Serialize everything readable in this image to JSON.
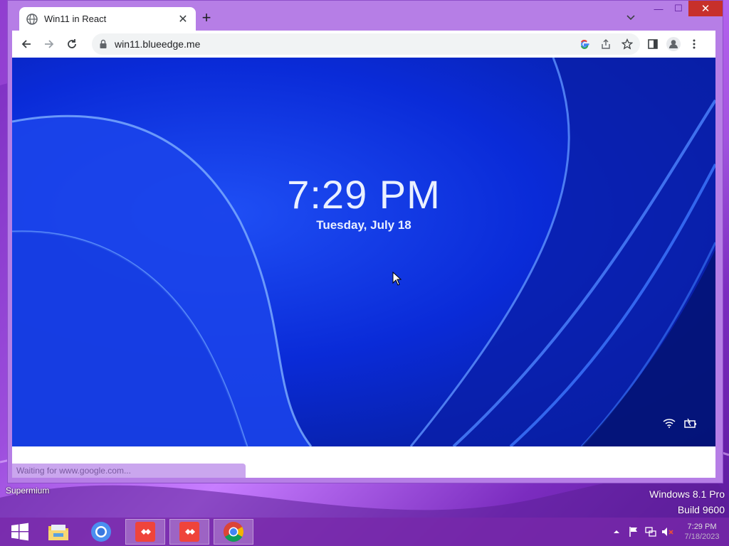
{
  "browser": {
    "tab_title": "Win11 in React",
    "new_tab_symbol": "+",
    "tab_close_symbol": "✕",
    "url": "win11.blueedge.me",
    "status_text": "Waiting for www.google.com...",
    "window_controls": {
      "minimize": "—",
      "maximize": "☐",
      "close": "✕"
    }
  },
  "lockscreen": {
    "time": "7:29 PM",
    "date": "Tuesday, July 18",
    "status_icons": [
      "wifi-icon",
      "battery-charging-icon"
    ]
  },
  "desktop": {
    "label": "Supermium",
    "watermark_line1": "Windows 8.1 Pro",
    "watermark_line2": "Build 9600"
  },
  "taskbar": {
    "items": [
      "start-button",
      "file-explorer",
      "chromium",
      "anydesk",
      "anydesk",
      "chrome"
    ],
    "clock_time": "7:29 PM",
    "clock_date": "7/18/2023"
  },
  "colors": {
    "desktop_accent": "#9d4edd",
    "lockscreen_blue": "#0a2bd8",
    "close_red": "#c7302b"
  }
}
